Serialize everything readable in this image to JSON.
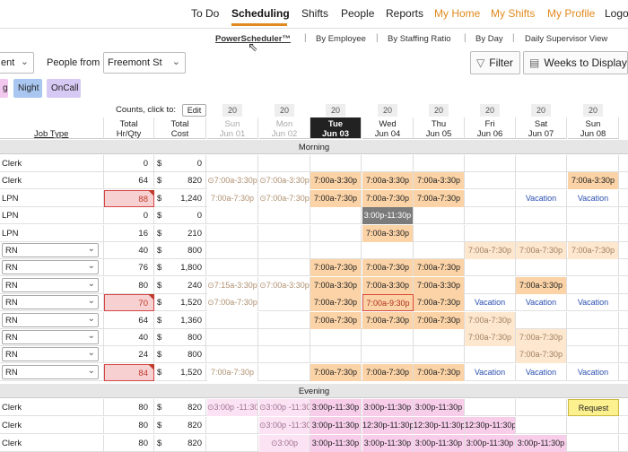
{
  "topnav": {
    "items": [
      "To Do",
      "Scheduling",
      "Shifts",
      "People",
      "Reports",
      "My Home",
      "My Shifts",
      "My Profile",
      "Logo"
    ]
  },
  "subnav": {
    "items": [
      "PowerScheduler™",
      "By Employee",
      "By Staffing Ratio",
      "By Day",
      "Daily Supervisor View"
    ]
  },
  "filters": {
    "dept_partial": "ent",
    "people_from_label": "People from",
    "location": "Freemont St",
    "filter_label": "Filter",
    "weeks_label": "Weeks to Display"
  },
  "pills": [
    {
      "label": "g",
      "color": "#f3c8ee"
    },
    {
      "label": "Night",
      "color": "#a9c6f0"
    },
    {
      "label": "OnCall",
      "color": "#d6c9f3"
    }
  ],
  "counts": {
    "label": "Counts, click to:",
    "edit": "Edit",
    "values": [
      "20",
      "20",
      "20",
      "20",
      "20",
      "20",
      "20",
      "20"
    ]
  },
  "grid_header": {
    "job_type": "Job Type",
    "total_hr": [
      "Total",
      "Hr/Qty"
    ],
    "total_cost": [
      "Total",
      "Cost"
    ],
    "days": [
      {
        "dow": "Sun",
        "date": "Jun 01"
      },
      {
        "dow": "Mon",
        "date": "Jun 02"
      },
      {
        "dow": "Tue",
        "date": "Jun 03"
      },
      {
        "dow": "Wed",
        "date": "Jun 04"
      },
      {
        "dow": "Thu",
        "date": "Jun 05"
      },
      {
        "dow": "Fri",
        "date": "Jun 06"
      },
      {
        "dow": "Sat",
        "date": "Jun 07"
      },
      {
        "dow": "Sun",
        "date": "Jun 08"
      }
    ]
  },
  "sections": {
    "morning": "Morning",
    "evening": "Evening"
  },
  "rows": [
    {
      "job": "Clerk",
      "select": false,
      "hr": "0",
      "cost": "0",
      "alert": false,
      "cells": [
        "",
        "",
        "",
        "",
        "",
        "",
        "",
        ""
      ]
    },
    {
      "job": "Clerk",
      "select": false,
      "hr": "64",
      "cost": "820",
      "alert": false,
      "cells": [
        "⊙7:00a-3:30p",
        "⊙7:00a-3:30p",
        "7:00a-3:30p",
        "7:00a-3:30p",
        "7:00a-3:30p",
        "",
        "",
        "7:00a-3:30p"
      ]
    },
    {
      "job": "LPN",
      "select": false,
      "hr": "88",
      "cost": "1,240",
      "alert": true,
      "cells": [
        "7:00a-7:30p",
        "⊙7:00a-7:30p",
        "7:00a-7:30p",
        "7:00a-7:30p",
        "7:00a-7:30p",
        "",
        "Vacation",
        "Vacation"
      ]
    },
    {
      "job": "LPN",
      "select": false,
      "hr": "0",
      "cost": "0",
      "alert": false,
      "cells": [
        "",
        "",
        "",
        "3:00p-11:30p",
        "",
        "",
        "",
        ""
      ]
    },
    {
      "job": "LPN",
      "select": false,
      "hr": "16",
      "cost": "210",
      "alert": false,
      "cells": [
        "",
        "",
        "",
        "7:00a-3:30p",
        "",
        "",
        "",
        ""
      ]
    },
    {
      "job": "RN",
      "select": true,
      "hr": "40",
      "cost": "800",
      "alert": false,
      "cells": [
        "",
        "",
        "",
        "",
        "",
        "7:00a-7:30p",
        "7:00a-7:30p",
        "7:00a-7:30p"
      ]
    },
    {
      "job": "RN",
      "select": true,
      "hr": "76",
      "cost": "1,800",
      "alert": false,
      "cells": [
        "",
        "",
        "7:00a-7:30p",
        "7:00a-7:30p",
        "7:00a-7:30p",
        "",
        "",
        ""
      ]
    },
    {
      "job": "RN",
      "select": true,
      "hr": "80",
      "cost": "240",
      "alert": false,
      "cells": [
        "⊙7:15a-3:30p",
        "⊙7:00a-3:30p",
        "7:00a-3:30p",
        "7:00a-3:30p",
        "7:00a-3:30p",
        "",
        "7:00a-3:30p",
        ""
      ]
    },
    {
      "job": "RN",
      "select": true,
      "hr": "70",
      "cost": "1,520",
      "alert": true,
      "cells": [
        "⊙7:00a-7:30p",
        "",
        "7:00a-7:30p",
        "7:00a-9:30p",
        "7:00a-7:30p",
        "Vacation",
        "Vacation",
        "Vacation"
      ]
    },
    {
      "job": "RN",
      "select": true,
      "hr": "64",
      "cost": "1,360",
      "alert": false,
      "cells": [
        "",
        "",
        "7:00a-7:30p",
        "7:00a-7:30p",
        "7:00a-7:30p",
        "7:00a-7:30p",
        "",
        ""
      ]
    },
    {
      "job": "RN",
      "select": true,
      "hr": "40",
      "cost": "800",
      "alert": false,
      "cells": [
        "",
        "",
        "",
        "",
        "",
        "7:00a-7:30p",
        "7:00a-7:30p",
        ""
      ]
    },
    {
      "job": "RN",
      "select": true,
      "hr": "24",
      "cost": "800",
      "alert": false,
      "cells": [
        "",
        "",
        "",
        "",
        "",
        "",
        "7:00a-7:30p",
        ""
      ]
    },
    {
      "job": "RN",
      "select": true,
      "hr": "84",
      "cost": "1,520",
      "alert": true,
      "cells": [
        "7:00a-7:30p",
        "",
        "7:00a-7:30p",
        "7:00a-7:30p",
        "7:00a-7:30p",
        "Vacation",
        "Vacation",
        "Vacation"
      ]
    }
  ],
  "evening_rows": [
    {
      "job": "Clerk",
      "hr": "80",
      "cost": "820",
      "cells": [
        "⊙3:00p -11:30p",
        "⊙3:00p -11:30p",
        "3:00p-11:30p",
        "3:00p-11:30p",
        "3:00p-11:30p",
        "",
        "",
        "Request"
      ]
    },
    {
      "job": "Clerk",
      "hr": "80",
      "cost": "820",
      "cells": [
        "",
        "⊙3:00p -11:30p",
        "3:00p-11:30p",
        "12:30p-11:30p",
        "12:30p-11:30p",
        "12:30p-11:30p",
        "",
        ""
      ]
    },
    {
      "job": "Clerk",
      "hr": "80",
      "cost": "820",
      "cells": [
        "",
        "⊙3:00p",
        "3:00p-11:30p",
        "3:00p-11:30p",
        "3:00p-11:30p",
        "3:00p-11:30p",
        "3:00p-11:30p",
        ""
      ]
    }
  ],
  "currency": "$"
}
